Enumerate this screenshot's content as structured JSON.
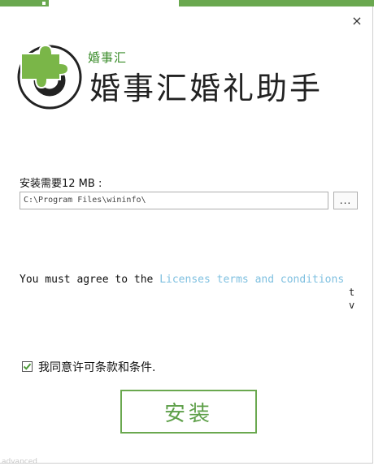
{
  "window": {
    "close_label": "×"
  },
  "brand": {
    "small_name": "婚事汇",
    "app_title": "婚事汇婚礼助手"
  },
  "install_path": {
    "label": "安装需要12 MB :",
    "value": "C:\\Program Files\\wininfo\\",
    "browse_label": "..."
  },
  "license": {
    "prefix": "You must agree to the ",
    "link_text": "Licenses terms and conditions",
    "stray_chars": [
      "t",
      "v"
    ]
  },
  "agreement": {
    "checked": true,
    "label": "我同意许可条款和条件."
  },
  "actions": {
    "install_label": "安装",
    "advanced_label": "advanced"
  },
  "colors": {
    "accent_green": "#6aa84f",
    "link_blue": "#7fc0e0",
    "text": "#111111"
  },
  "icons": {
    "logo": "puzzle-disc-logo",
    "close": "close-icon",
    "check": "checkmark-icon"
  }
}
